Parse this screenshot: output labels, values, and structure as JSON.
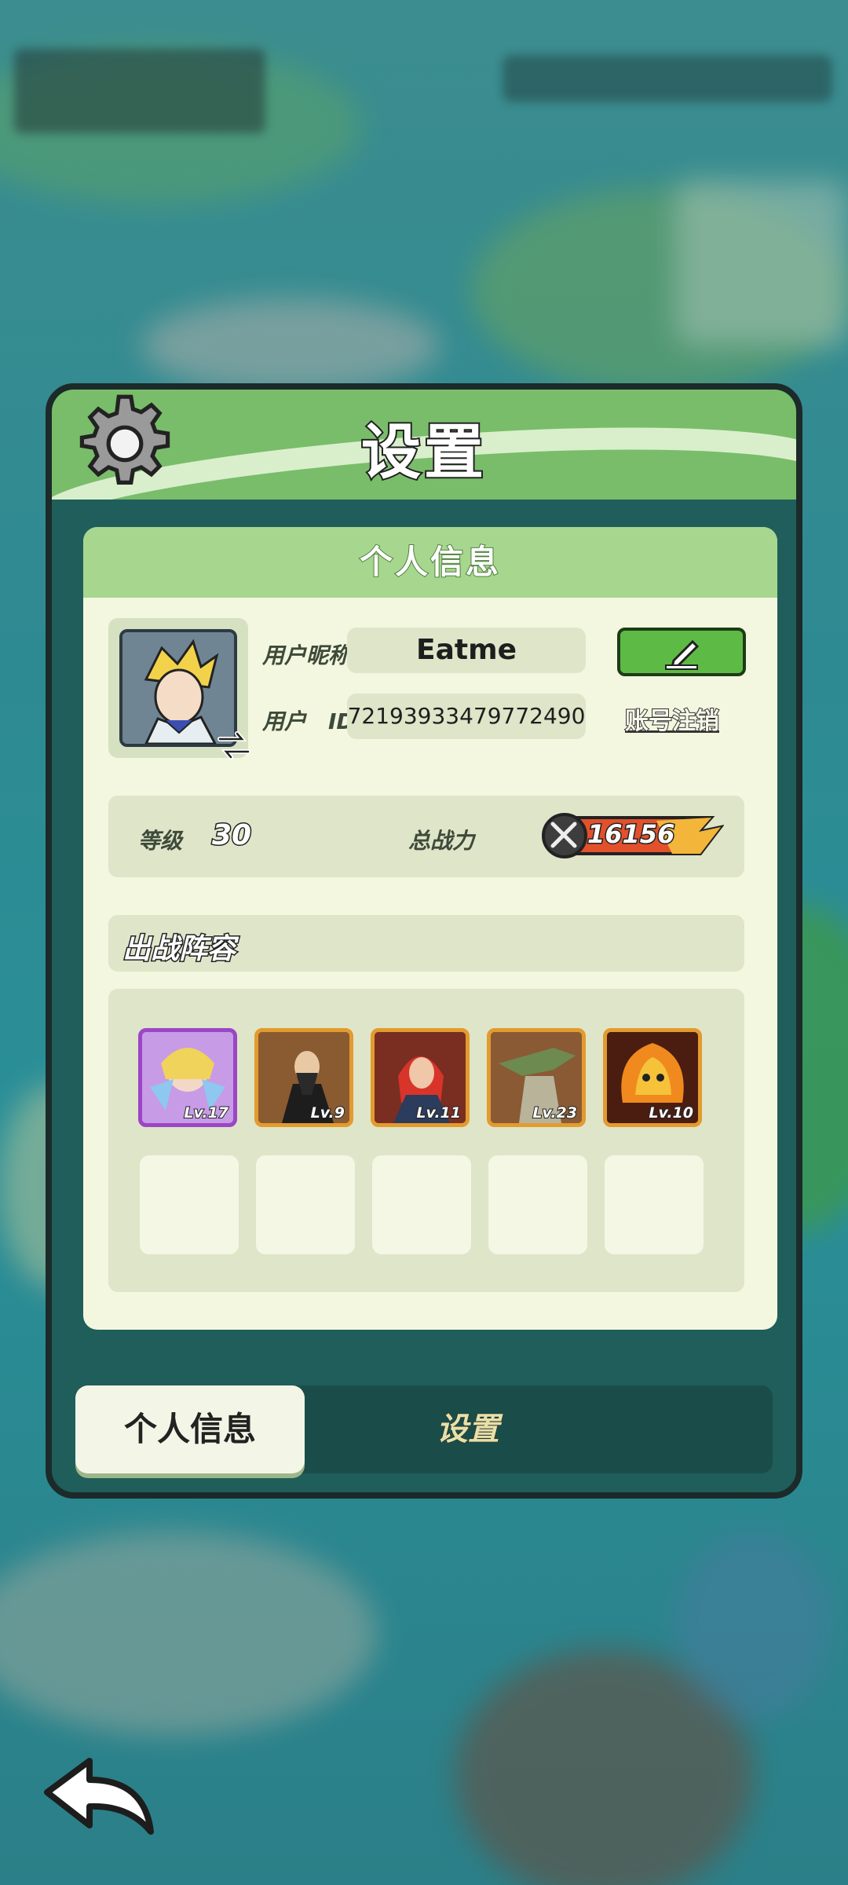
{
  "dialog": {
    "title": "设置",
    "section_title": "个人信息"
  },
  "profile": {
    "nickname_label": "用户昵称",
    "nickname_value": "Eatme",
    "id_label": "用户　ID",
    "id_value": "72193933479772490",
    "cancel_account_label": "账号注销",
    "level_label": "等级",
    "level_value": "30",
    "power_label": "总战力",
    "power_value": "16156"
  },
  "lineup": {
    "title": "出战阵容",
    "heroes": [
      {
        "level": "Lv.17",
        "frame_color": "#9b46c6",
        "bg": "#bf8de0"
      },
      {
        "level": "Lv.9",
        "frame_color": "#e39b2e",
        "bg": "#7a4a2b"
      },
      {
        "level": "Lv.11",
        "frame_color": "#e39b2e",
        "bg": "#8b3b2a"
      },
      {
        "level": "Lv.23",
        "frame_color": "#e39b2e",
        "bg": "#7d5130"
      },
      {
        "level": "Lv.10",
        "frame_color": "#e39b2e",
        "bg": "#6b2a16"
      }
    ]
  },
  "tabs": {
    "profile": "个人信息",
    "settings": "设置"
  },
  "icons": {
    "gear": "gear-icon",
    "edit": "pencil-icon",
    "swap": "swap-arrows-icon",
    "power": "crossed-swords-icon",
    "back": "back-arrow-icon"
  },
  "colors": {
    "header_green": "#79bd6b",
    "content_bg": "#f3f7df",
    "edit_button": "#5dbb45",
    "hero_frame_gold": "#e39b2e",
    "hero_frame_purple": "#9b46c6"
  }
}
